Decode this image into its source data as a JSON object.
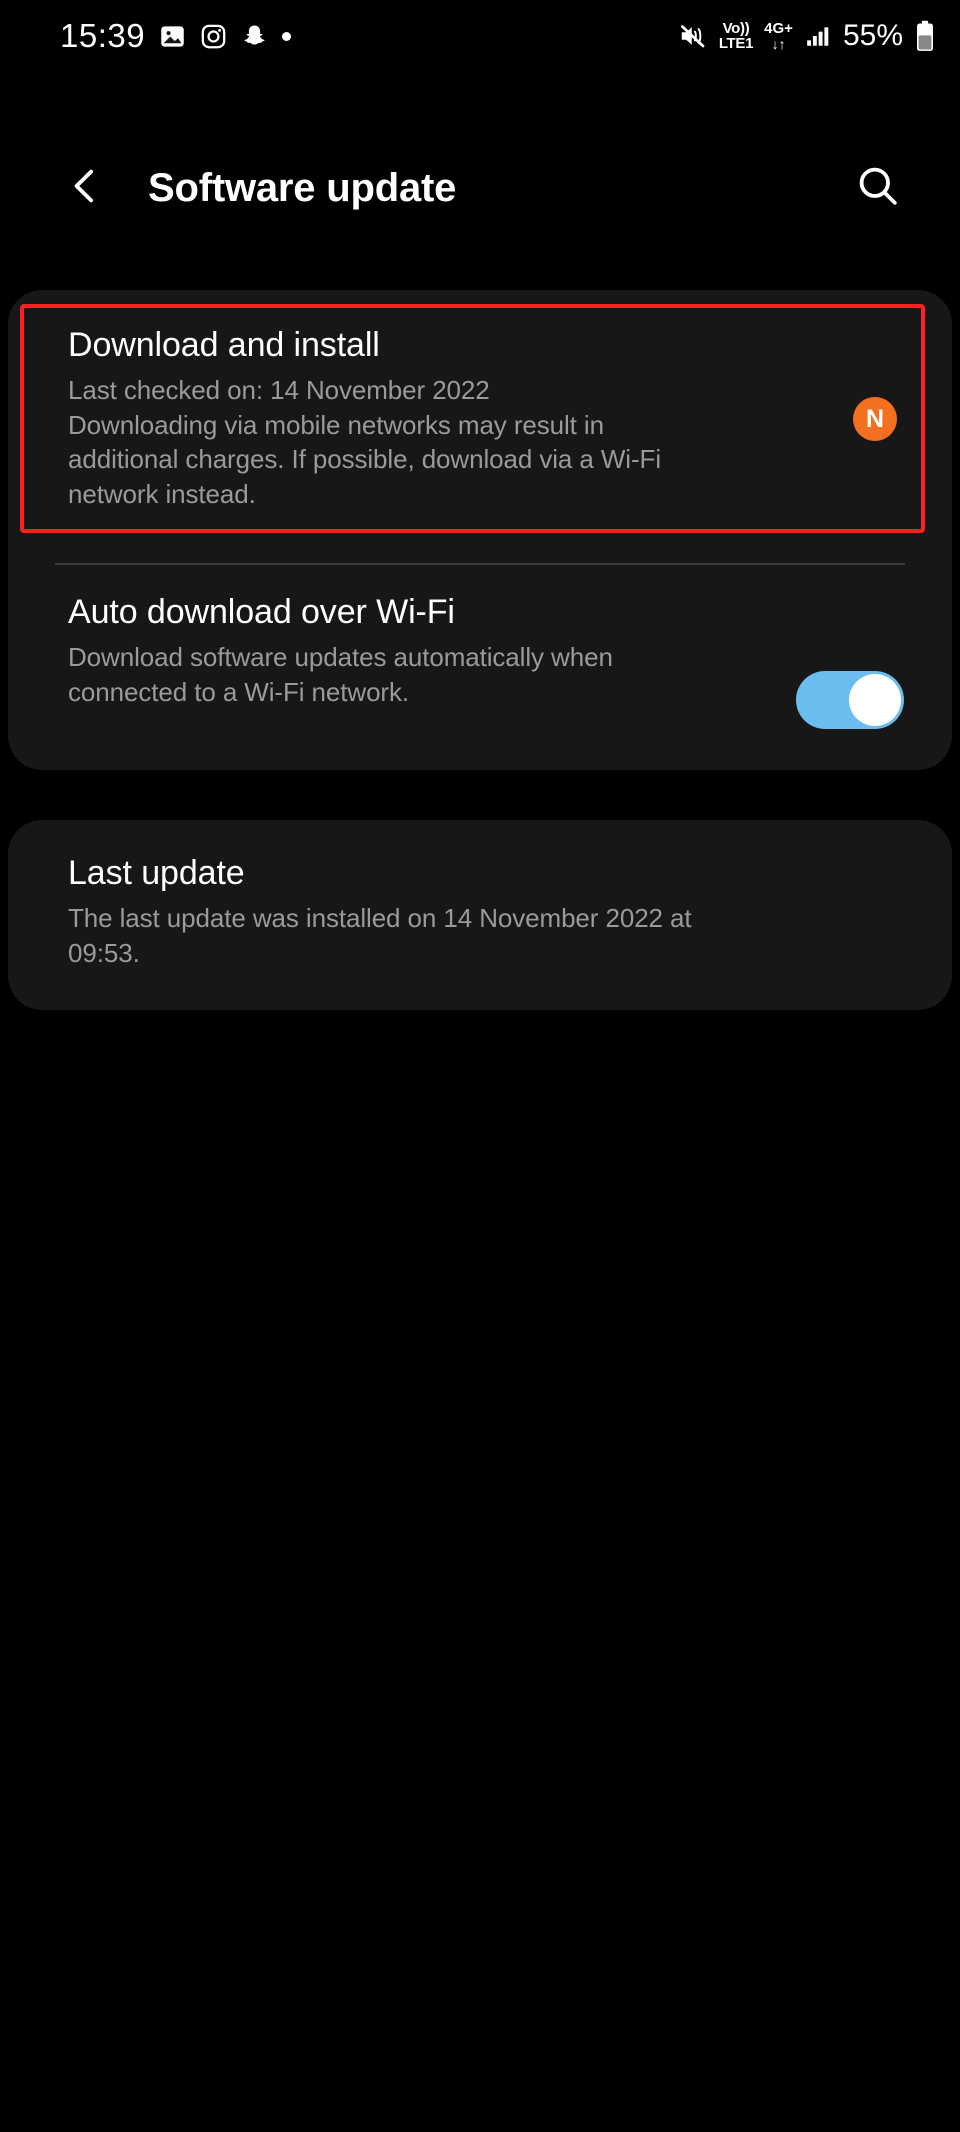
{
  "status_bar": {
    "time": "15:39",
    "left_icons": [
      {
        "name": "gallery-icon",
        "glyph": "image"
      },
      {
        "name": "instagram-icon",
        "glyph": "instagram"
      },
      {
        "name": "snapchat-icon",
        "glyph": "snapchat"
      },
      {
        "name": "more-notifications-dot",
        "glyph": "dot"
      }
    ],
    "mute_icon": "sound-mute-icon",
    "volte_line1": "Vo))",
    "volte_line2": "LTE1",
    "network_type": "4G+",
    "data_arrows": "↓↑",
    "signal_icon": "signal-bars-icon",
    "battery_percent": "55%",
    "battery_icon": "battery-icon"
  },
  "header": {
    "back_icon": "back-chevron-icon",
    "title": "Software update",
    "search_icon": "search-icon"
  },
  "update_card": {
    "download": {
      "title": "Download and install",
      "sub_line1": "Last checked on: 14 November 2022",
      "sub_line2": "Downloading via mobile networks may result in",
      "sub_line3": "additional charges. If possible, download via a Wi-Fi",
      "sub_line4": "network instead.",
      "badge_letter": "N",
      "badge_color": "#F37021"
    },
    "auto_download": {
      "title": "Auto download over Wi-Fi",
      "sub_line1": "Download software updates automatically when",
      "sub_line2": "connected to a Wi-Fi network.",
      "toggle_state": "on",
      "toggle_color": "#6BBCEF"
    }
  },
  "last_update_card": {
    "title": "Last update",
    "sub_line1": "The last update was installed on 14 November 2022 at",
    "sub_line2": "09:53."
  },
  "highlight": {
    "color": "#FF2020",
    "target": "Download and install"
  }
}
